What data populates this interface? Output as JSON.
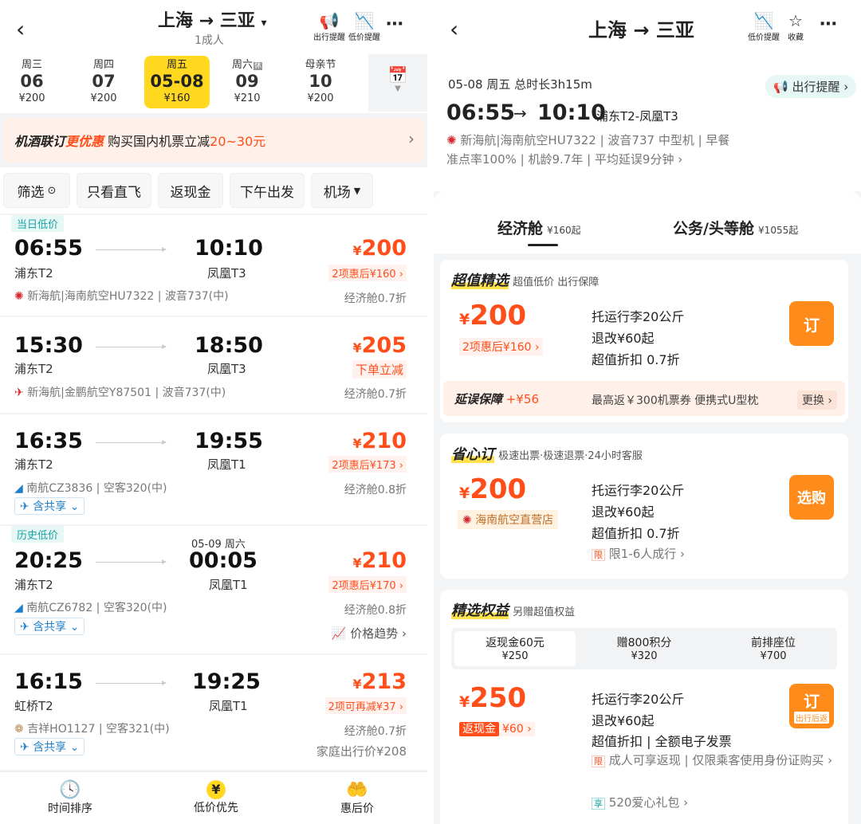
{
  "left": {
    "route": "上海 → 三亚",
    "route_caret": "▾",
    "passengers": "1成人",
    "icons": [
      {
        "name": "bell-icon",
        "label": "出行提醒"
      },
      {
        "name": "price-alert-icon",
        "label": "低价提醒"
      }
    ],
    "dates": [
      {
        "weekday": "周三",
        "day": "06",
        "price": "¥200"
      },
      {
        "weekday": "周四",
        "day": "07",
        "price": "¥200"
      },
      {
        "weekday": "周五",
        "day": "05-08",
        "price": "¥160"
      },
      {
        "weekday": "周六",
        "badge": "休",
        "day": "09",
        "price": "¥210"
      },
      {
        "weekday": "母亲节",
        "day": "10",
        "price": "¥200"
      }
    ],
    "promo": {
      "brand": "机酒联订",
      "highlight": "更优惠",
      "text": "购买国内机票立减",
      "amount": "20~30元"
    },
    "filters": [
      "筛选",
      "只看直飞",
      "返现金",
      "下午出发",
      "机场"
    ],
    "flights": [
      {
        "tag": "当日低价",
        "dep": "06:55",
        "arr": "10:10",
        "dep_apt": "浦东T2",
        "arr_apt": "凤凰T3",
        "price": "200",
        "sub": "2项惠后¥160 ›",
        "airline": "新海航|海南航空HU7322",
        "plane": "波音737(中)",
        "cabin": "经济舱0.7折"
      },
      {
        "dep": "15:30",
        "arr": "18:50",
        "dep_apt": "浦东T2",
        "arr_apt": "凤凰T3",
        "price": "205",
        "sub": "下单立减",
        "airline": "新海航|金鹏航空Y87501",
        "plane": "波音737(中)",
        "cabin": "经济舱0.7折"
      },
      {
        "dep": "16:35",
        "arr": "19:55",
        "dep_apt": "浦东T2",
        "arr_apt": "凤凰T1",
        "price": "210",
        "sub": "2项惠后¥173 ›",
        "airline": "南航CZ3836",
        "plane": "空客320(中)",
        "cabin": "经济舱0.8折",
        "share": "含共享"
      },
      {
        "tag": "历史低价",
        "next_day": "05-09 周六",
        "dep": "20:25",
        "arr": "00:05",
        "dep_apt": "浦东T2",
        "arr_apt": "凤凰T1",
        "price": "210",
        "sub": "2项惠后¥170 ›",
        "airline": "南航CZ6782",
        "plane": "空客320(中)",
        "cabin": "经济舱0.8折",
        "share": "含共享",
        "trend": "价格趋势 ›"
      },
      {
        "dep": "16:15",
        "arr": "19:25",
        "dep_apt": "虹桥T2",
        "arr_apt": "凤凰T1",
        "price": "213",
        "sub": "2项可再减¥37 ›",
        "airline": "吉祥HO1127",
        "plane": "空客321(中)",
        "cabin": "经济舱0.7折",
        "share": "含共享",
        "family": "家庭出行价¥208"
      }
    ],
    "bottom": [
      {
        "name": "clock-icon",
        "label": "时间排序"
      },
      {
        "name": "yen-icon",
        "label": "低价优先"
      },
      {
        "name": "discount-icon",
        "label": "惠后价"
      }
    ]
  },
  "right": {
    "title": "上海 → 三亚",
    "icons": [
      {
        "name": "price-alert-icon",
        "label": "低价提醒"
      },
      {
        "name": "star-icon",
        "label": "收藏"
      }
    ],
    "date_line": "05-08 周五  总时长3h15m",
    "remind": "出行提醒 ›",
    "dep": "06:55",
    "arr": "10:10",
    "airports": "浦东T2-凤凰T3",
    "airline_line": "新海航|海南航空HU7322 | 波音737 中型机 | 早餐",
    "stats": "准点率100% | 机龄9.7年 | 平均延误9分钟 ›",
    "tabs": [
      {
        "label": "经济舱",
        "price": "¥160起"
      },
      {
        "label": "公务/头等舱",
        "price": "¥1055起"
      }
    ],
    "offer1": {
      "title": "超值精选",
      "desc": "超值低价 出行保障",
      "price": "200",
      "sub": "2项惠后¥160 ›",
      "features": [
        "托运行李20公斤",
        "退改¥60起",
        "超值折扣 0.7折"
      ],
      "btn": "订",
      "delay_title": "延误保障",
      "delay_price": "+¥56",
      "delay_text": "最高返￥300机票券 便携式U型枕",
      "change": "更换 ›"
    },
    "offer2": {
      "title": "省心订",
      "desc": "极速出票·极速退票·24小时客服",
      "price": "200",
      "store": "海南航空直营店",
      "features": [
        "托运行李20公斤",
        "退改¥60起",
        "超值折扣 0.7折"
      ],
      "limit_badge": "限",
      "limit": "限1-6人成行 ›",
      "btn": "选购"
    },
    "offer3": {
      "title": "精选权益",
      "desc": "另赠超值权益",
      "options": [
        {
          "label": "返现金60元",
          "price": "¥250"
        },
        {
          "label": "赠800积分",
          "price": "¥320"
        },
        {
          "label": "前排座位",
          "price": "¥700"
        }
      ],
      "price": "250",
      "cash_badge": "返现金",
      "cash": "¥60 ›",
      "features": [
        "托运行李20公斤",
        "退改¥60起",
        "超值折扣 | 全额电子发票"
      ],
      "limit_badge": "限",
      "limit": "成人可享返现 | 仅限乘客使用身份证购买 ›",
      "gift_badge": "享",
      "gift": "520爱心礼包 ›",
      "btn": "订",
      "btn_sub": "出行后返"
    }
  },
  "colors": {
    "accent": "#ff4e1a",
    "yellow": "#ffd81f",
    "order": "#ff8b1a",
    "teal": "#1aa3a3"
  }
}
